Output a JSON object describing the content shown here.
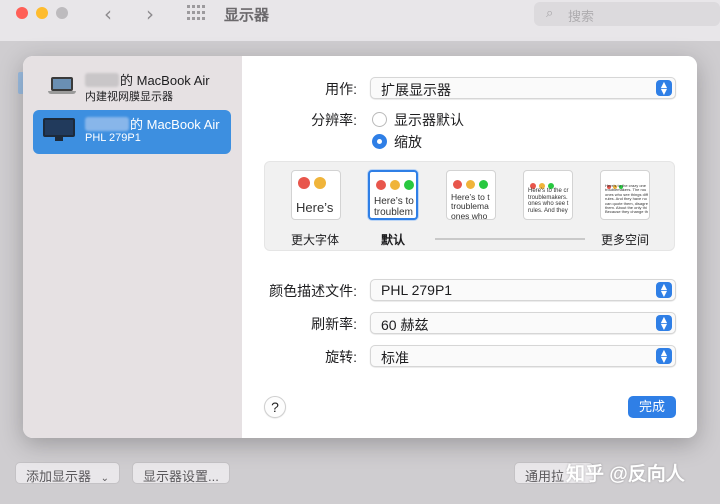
{
  "background_window": {
    "title": "显示器",
    "search_placeholder": "搜索",
    "bottom_buttons": {
      "add_display": "添加显示器",
      "display_settings": "显示器设置...",
      "general_partial": "通用拉"
    }
  },
  "watermark": "知乎 @反向人",
  "sidebar": {
    "items": [
      {
        "name": "的 MacBook Air",
        "subtitle": "内建视网膜显示器",
        "icon": "laptop-icon",
        "selected": false
      },
      {
        "name": "的 MacBook Air",
        "subtitle": "PHL 279P1",
        "icon": "monitor-icon",
        "selected": true
      }
    ]
  },
  "settings": {
    "use_as_label": "用作:",
    "use_as_value": "扩展显示器",
    "resolution_label": "分辨率:",
    "resolution_options": [
      {
        "label": "显示器默认",
        "selected": false
      },
      {
        "label": "缩放",
        "selected": true
      }
    ],
    "scale_options": [
      {
        "label": "更大字体",
        "preview_text": "Here’s",
        "selected": false
      },
      {
        "label": "默认",
        "preview_text": "Here’s to troublem",
        "selected": true
      },
      {
        "label": "",
        "preview_text": "Here’s to t troublema ones who",
        "selected": false
      },
      {
        "label": "",
        "preview_text": "Here's to the cr troublemakers. ones who see t rules. And they",
        "selected": false
      },
      {
        "label": "更多空间",
        "preview_text": "Here's to the crazy one troublemakers. The rou ones who see things diff rules. And they have no can quote them, disagre them. About the only thi Because they change th",
        "selected": false
      }
    ],
    "color_profile_label": "颜色描述文件:",
    "color_profile_value": "PHL 279P1",
    "refresh_rate_label": "刷新率:",
    "refresh_rate_value": "60 赫兹",
    "rotation_label": "旋转:",
    "rotation_value": "标准",
    "help_label": "?",
    "done_label": "完成"
  },
  "colors": {
    "accent": "#2f7fe6",
    "sidebar_selected": "#3d8fe0",
    "traffic_red": "#ff5f57",
    "traffic_yellow": "#febc2e",
    "traffic_green": "#28c840"
  }
}
